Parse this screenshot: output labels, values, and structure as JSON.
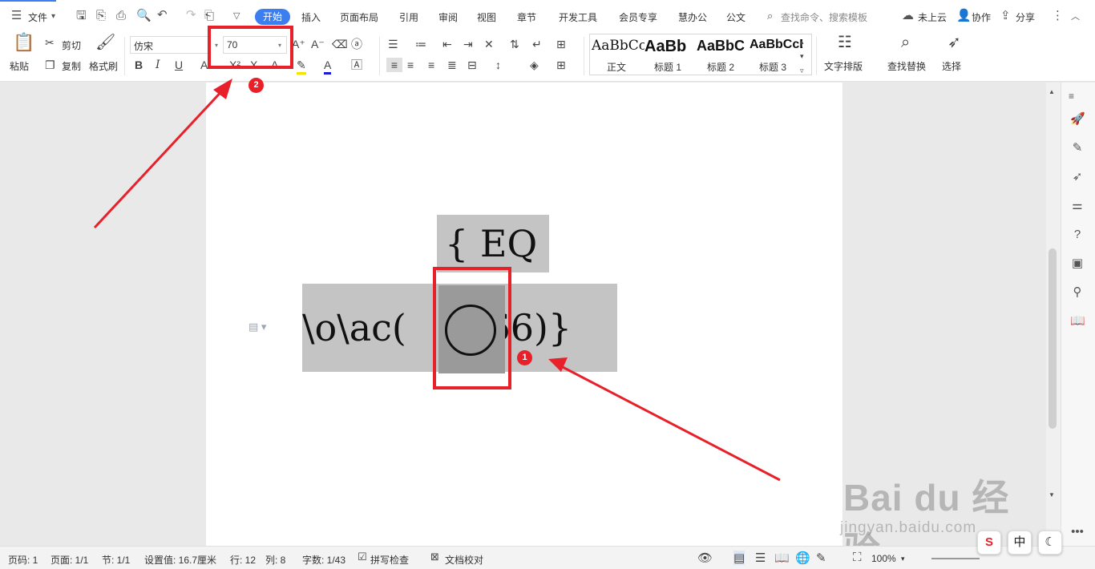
{
  "menu": {
    "file_label": "文件",
    "tabs": [
      "开始",
      "插入",
      "页面布局",
      "引用",
      "审阅",
      "视图",
      "章节",
      "开发工具",
      "会员专享",
      "慧办公",
      "公文"
    ],
    "search_placeholder": "查找命令、搜索模板",
    "cloud_label": "未上云",
    "collab_label": "协作",
    "share_label": "分享"
  },
  "ribbon": {
    "paste": "粘贴",
    "cut": "剪切",
    "copy": "复制",
    "format_painter": "格式刷",
    "font_name": "仿宋",
    "font_size": "70",
    "styles": [
      {
        "preview": "AaBbCcDd",
        "label": "正文"
      },
      {
        "preview": "AaBb",
        "label": "标题 1"
      },
      {
        "preview": "AaBbC",
        "label": "标题 2"
      },
      {
        "preview": "AaBbCcD",
        "label": "标题 3"
      }
    ],
    "text_layout": "文字排版",
    "find_replace": "查找替换",
    "select": "选择"
  },
  "document": {
    "field_top": "{ EQ",
    "field_main_left": "\\o\\ac(",
    "field_main_right": ",66)}"
  },
  "annotations": {
    "badge1": "1",
    "badge2": "2",
    "color": "#e8202a"
  },
  "status": {
    "page": "页码: 1",
    "pages": "页面: 1/1",
    "section": "节: 1/1",
    "setting": "设置值: 16.7厘米",
    "row": "行: 12",
    "col": "列: 8",
    "words": "字数: 1/43",
    "spell": "拼写检查",
    "proof": "文档校对",
    "zoom": "100%"
  },
  "watermark": {
    "main": "Bai du 经验",
    "sub": "jingyan.baidu.com"
  },
  "ime": {
    "lang": "中"
  }
}
